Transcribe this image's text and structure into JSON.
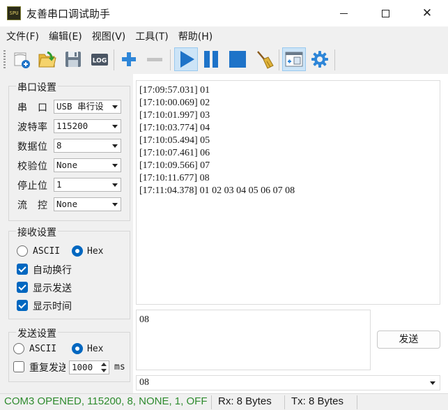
{
  "window": {
    "title": "友善串口调试助手",
    "icon_text": "SPU"
  },
  "menu": [
    {
      "label": "文件(F)"
    },
    {
      "label": "编辑(E)"
    },
    {
      "label": "视图(V)"
    },
    {
      "label": "工具(T)"
    },
    {
      "label": "帮助(H)"
    }
  ],
  "toolbar": {
    "log_label": "LOG",
    "icons": [
      "new-session-icon",
      "open-icon",
      "save-icon",
      "log-icon",
      "add-icon",
      "remove-icon",
      "start-icon",
      "pause-icon",
      "stop-icon",
      "clear-icon",
      "window-icon",
      "settings-icon"
    ]
  },
  "serial_settings": {
    "title": "串口设置",
    "rows": [
      {
        "label": "串　口",
        "value": "USB 串行设"
      },
      {
        "label": "波特率",
        "value": "115200"
      },
      {
        "label": "数据位",
        "value": "8"
      },
      {
        "label": "校验位",
        "value": "None"
      },
      {
        "label": "停止位",
        "value": "1"
      },
      {
        "label": "流　控",
        "value": "None"
      }
    ]
  },
  "receive_settings": {
    "title": "接收设置",
    "ascii_label": "ASCII",
    "hex_label": "Hex",
    "selected_mode": "Hex",
    "checks": [
      {
        "label": "自动换行",
        "checked": true
      },
      {
        "label": "显示发送",
        "checked": true
      },
      {
        "label": "显示时间",
        "checked": true
      }
    ]
  },
  "send_settings": {
    "title": "发送设置",
    "ascii_label": "ASCII",
    "hex_label": "Hex",
    "selected_mode": "Hex",
    "repeat_label": "重复发送",
    "repeat_checked": false,
    "interval_value": "1000",
    "interval_unit": "ms"
  },
  "receive_log": [
    "[17:09:57.031] 01",
    "[17:10:00.069] 02",
    "[17:10:01.997] 03",
    "[17:10:03.774] 04",
    "[17:10:05.494] 05",
    "[17:10:07.461] 06",
    "[17:10:09.566] 07",
    "[17:10:11.677] 08",
    "[17:11:04.378] 01 02 03 04 05 06 07 08"
  ],
  "send": {
    "input_value": "08",
    "button_label": "发送",
    "history_value": "08"
  },
  "status": {
    "connection": "COM3 OPENED, 115200, 8, NONE, 1, OFF",
    "rx": "Rx: 8 Bytes",
    "tx": "Tx: 8 Bytes",
    "connection_color": "#2e8b2e"
  }
}
